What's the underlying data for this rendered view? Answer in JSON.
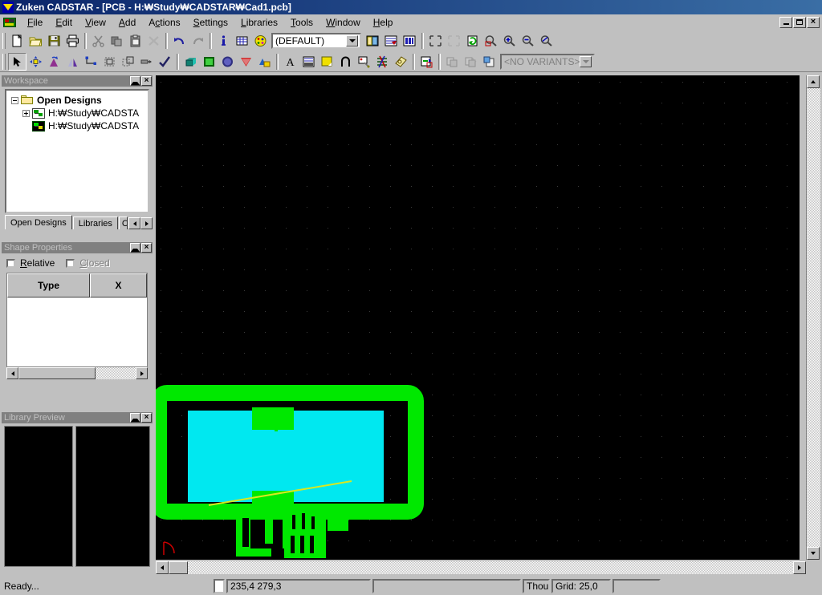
{
  "window": {
    "title": "Zuken CADSTAR - [PCB - H:₩Study₩CADSTAR₩Cad1.pcb]",
    "app_icon": "cadstar-logo-icon",
    "mdi_minimize": "minimize-icon",
    "mdi_restore": "restore-icon",
    "mdi_close": "close-icon"
  },
  "menu": {
    "doc_icon": "pcb-document-icon",
    "items": [
      {
        "label": "File",
        "mnemonic": "F"
      },
      {
        "label": "Edit",
        "mnemonic": "E"
      },
      {
        "label": "View",
        "mnemonic": "V"
      },
      {
        "label": "Add",
        "mnemonic": "A"
      },
      {
        "label": "Actions",
        "mnemonic": "c"
      },
      {
        "label": "Settings",
        "mnemonic": "S"
      },
      {
        "label": "Libraries",
        "mnemonic": "L"
      },
      {
        "label": "Tools",
        "mnemonic": "T"
      },
      {
        "label": "Window",
        "mnemonic": "W"
      },
      {
        "label": "Help",
        "mnemonic": "H"
      }
    ]
  },
  "toolbar_main": {
    "buttons": [
      {
        "name": "new-icon",
        "tip": "New"
      },
      {
        "name": "open-folder-icon",
        "tip": "Open"
      },
      {
        "name": "save-disk-icon",
        "tip": "Save"
      },
      {
        "name": "print-icon",
        "tip": "Print"
      },
      {
        "name": "cut-scissors-icon",
        "tip": "Cut"
      },
      {
        "name": "copy-icon",
        "tip": "Copy"
      },
      {
        "name": "paste-clipboard-icon",
        "tip": "Paste"
      },
      {
        "name": "delete-x-icon",
        "tip": "Delete"
      },
      {
        "name": "undo-arrow-icon",
        "tip": "Undo"
      },
      {
        "name": "redo-arrow-icon",
        "tip": "Redo"
      },
      {
        "name": "info-icon",
        "tip": "Information"
      },
      {
        "name": "grid-table-icon",
        "tip": "Grids"
      },
      {
        "name": "colours-palette-icon",
        "tip": "Colours"
      }
    ],
    "layer_combo_value": "(DEFAULT)",
    "right_buttons": [
      {
        "name": "layers-icon",
        "tip": "Layers"
      },
      {
        "name": "net-classes-icon",
        "tip": "Net Classes"
      },
      {
        "name": "spacing-classes-icon",
        "tip": "Spacing Classes"
      },
      {
        "name": "zoom-fit-icon",
        "tip": "Zoom Fit"
      },
      {
        "name": "zoom-selection-icon",
        "tip": "Zoom Selection"
      },
      {
        "name": "redraw-icon",
        "tip": "Redraw"
      },
      {
        "name": "zoom-window-icon",
        "tip": "Zoom Window"
      },
      {
        "name": "zoom-in-icon",
        "tip": "Zoom In"
      },
      {
        "name": "zoom-out-icon",
        "tip": "Zoom Out"
      },
      {
        "name": "zoom-previous-icon",
        "tip": "Zoom Previous"
      }
    ]
  },
  "toolbar_edit": {
    "buttons": [
      {
        "name": "select-arrow-icon",
        "tip": "Select",
        "pressed": true
      },
      {
        "name": "move-icon",
        "tip": "Move"
      },
      {
        "name": "rotate-icon",
        "tip": "Rotate"
      },
      {
        "name": "mirror-icon",
        "tip": "Mirror"
      },
      {
        "name": "change-shape-icon",
        "tip": "Change Shape"
      },
      {
        "name": "group-icon",
        "tip": "Group"
      },
      {
        "name": "ungroup-icon",
        "tip": "Ungroup"
      },
      {
        "name": "align-icon",
        "tip": "Align"
      },
      {
        "name": "check-icon",
        "tip": "Check"
      },
      {
        "name": "add-component-icon",
        "tip": "Add Component"
      },
      {
        "name": "add-copper-icon",
        "tip": "Add Copper"
      },
      {
        "name": "add-template-icon",
        "tip": "Add Template"
      },
      {
        "name": "add-keepout-icon",
        "tip": "Add Keepout"
      },
      {
        "name": "add-figure-icon",
        "tip": "Add Figure"
      },
      {
        "name": "add-text-icon",
        "tip": "Add Text"
      },
      {
        "name": "add-dimension-icon",
        "tip": "Add Dimension"
      },
      {
        "name": "add-area-icon",
        "tip": "Add Area"
      },
      {
        "name": "add-route-icon",
        "tip": "Add Route"
      },
      {
        "name": "add-testpoint-icon",
        "tip": "Add Test Point"
      },
      {
        "name": "route-editor-icon",
        "tip": "Route Editor"
      },
      {
        "name": "design-rules-icon",
        "tip": "Design Rules"
      },
      {
        "name": "embedded-board-icon",
        "tip": "Embedded Board"
      },
      {
        "name": "variant-manager-icon",
        "tip": "Variant Manager"
      },
      {
        "name": "variant-compare-icon",
        "tip": "Variant Compare"
      },
      {
        "name": "variant-copy-icon",
        "tip": "Variant Copy"
      }
    ],
    "variants_combo_value": "<NO VARIANTS>"
  },
  "workspace_panel": {
    "title": "Workspace",
    "maximize_icon": "panel-maximize-icon",
    "close_icon": "panel-close-icon",
    "tree": {
      "root": {
        "label": "Open Designs",
        "icon": "folder-icon",
        "expander": "minus"
      },
      "children": [
        {
          "label": "H:₩Study₩CADSTA",
          "icon": "pcb-design-icon",
          "expander": "plus"
        },
        {
          "label": "H:₩Study₩CADSTA",
          "icon": "pcb-board-icon",
          "expander": "none"
        }
      ]
    },
    "tabs": [
      {
        "label": "Open Designs",
        "active": true
      },
      {
        "label": "Libraries",
        "active": false
      },
      {
        "label": "C",
        "active": false
      }
    ],
    "tab_prev_icon": "tab-prev-icon",
    "tab_next_icon": "tab-next-icon"
  },
  "shape_panel": {
    "title": "Shape Properties",
    "maximize_icon": "panel-maximize-icon",
    "close_icon": "panel-close-icon",
    "checkboxes": [
      {
        "label": "Relative",
        "mnemonic": "R",
        "checked": false,
        "disabled": false
      },
      {
        "label": "Closed",
        "mnemonic": "C",
        "checked": false,
        "disabled": true
      }
    ],
    "columns": [
      "Type",
      "X"
    ],
    "rows": []
  },
  "library_panel": {
    "title": "Library Preview",
    "maximize_icon": "panel-maximize-icon",
    "close_icon": "panel-close-icon"
  },
  "canvas": {
    "background_color": "#000000",
    "grid_dot_color": "#3a3a3a",
    "origin_marker": "origin-arc-marker",
    "origin_color": "#cc0000",
    "board_outline_color": "#00e800",
    "copper_fill_color": "#00e8f0",
    "ratsnest_color": "#d8e820"
  },
  "statusbar": {
    "message": "Ready...",
    "coordinates": "235,4  279,3",
    "blank": "",
    "units": "Thou",
    "grid": "Grid: 25,0",
    "end": ""
  }
}
